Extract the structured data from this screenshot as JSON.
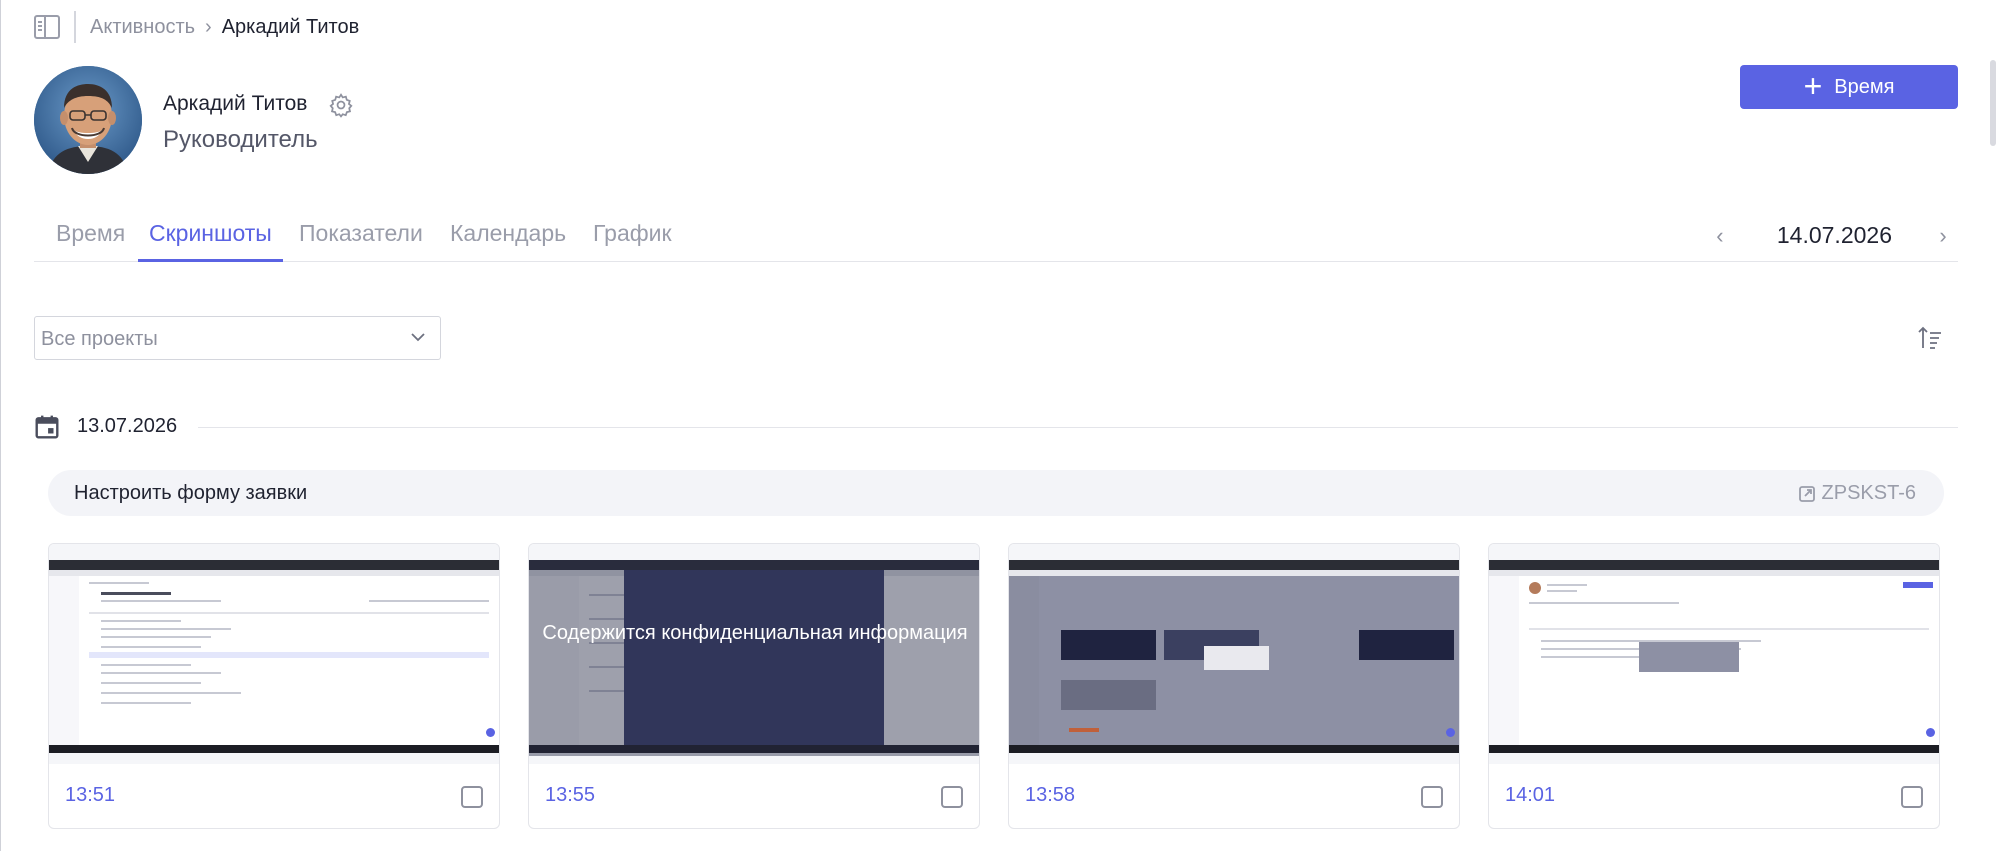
{
  "breadcrumb": {
    "parent": "Активность",
    "current": "Аркадий Титов"
  },
  "profile": {
    "name": "Аркадий Титов",
    "role": "Руководитель"
  },
  "actions": {
    "add_time_label": "Время"
  },
  "tabs": [
    {
      "label": "Время",
      "active": false
    },
    {
      "label": "Скриншоты",
      "active": true
    },
    {
      "label": "Показатели",
      "active": false
    },
    {
      "label": "Календарь",
      "active": false
    },
    {
      "label": "График",
      "active": false
    }
  ],
  "date_nav": {
    "date": "14.07.2026"
  },
  "filters": {
    "project_value": "Все проекты"
  },
  "groups": [
    {
      "date": "13.07.2026",
      "task": {
        "title": "Настроить форму заявки",
        "key": "ZPSKST-6"
      },
      "screenshots": [
        {
          "time": "13:51",
          "confidential": false,
          "confidential_text": ""
        },
        {
          "time": "13:55",
          "confidential": true,
          "confidential_text": "Содержится конфиденциальная информация"
        },
        {
          "time": "13:58",
          "confidential": false,
          "confidential_text": ""
        },
        {
          "time": "14:01",
          "confidential": false,
          "confidential_text": ""
        }
      ]
    }
  ],
  "colors": {
    "accent": "#5a63e3",
    "muted": "#9a9daa",
    "text": "#1f2230"
  },
  "icons": [
    "sidebar-toggle-icon",
    "gear-icon",
    "plus-icon",
    "chevron-left-icon",
    "chevron-right-icon",
    "chevron-down-icon",
    "sort-icon",
    "calendar-icon",
    "external-link-icon"
  ]
}
